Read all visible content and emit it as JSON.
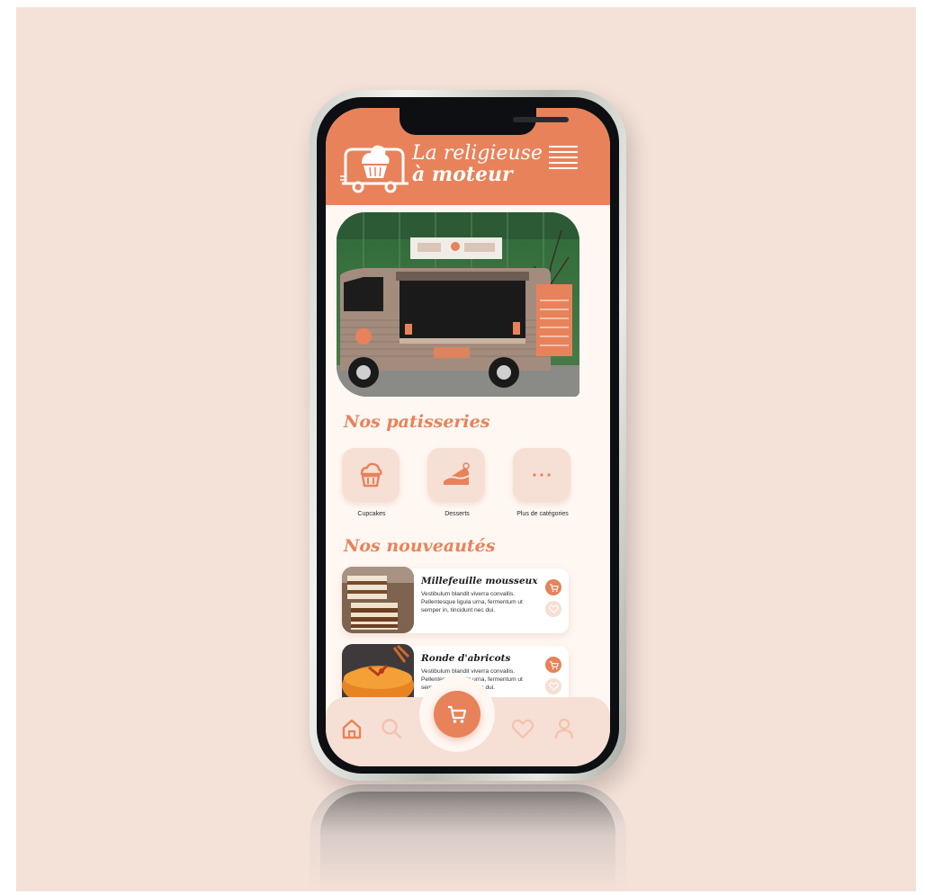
{
  "app": {
    "brand_line1": "La religieuse",
    "brand_line2": "à moteur"
  },
  "colors": {
    "accent": "#e8825a",
    "tile": "#f6dfd4",
    "screen_bg": "#fff7f2",
    "backdrop": "#f4e1d8"
  },
  "header": {
    "logo_icon": "cupcake-truck-logo",
    "menu_icon": "hamburger-menu-icon"
  },
  "sections": {
    "pastries_title": "Nos patisseries",
    "news_title": "Nos nouveautés"
  },
  "categories": [
    {
      "label": "Cupcakes",
      "icon": "cupcake-icon"
    },
    {
      "label": "Desserts",
      "icon": "cake-slice-icon"
    },
    {
      "label": "Plus de catégories",
      "icon": "more-dots-icon"
    }
  ],
  "products": [
    {
      "name": "Millefeuille mousseux",
      "description": "Vestibulum blandit viverra convallis. Pellentesque ligula urna, fermentum ut semper in, tincidunt nec dui."
    },
    {
      "name": "Ronde d'abricots",
      "description": "Vestibulum blandit viverra convallis. Pellentesque ligula urna, fermentum ut semper in, tincidunt nec dui."
    }
  ],
  "tabbar": {
    "items": [
      "home-icon",
      "search-icon",
      "cart-icon",
      "heart-icon",
      "user-icon"
    ],
    "active": "home-icon"
  }
}
